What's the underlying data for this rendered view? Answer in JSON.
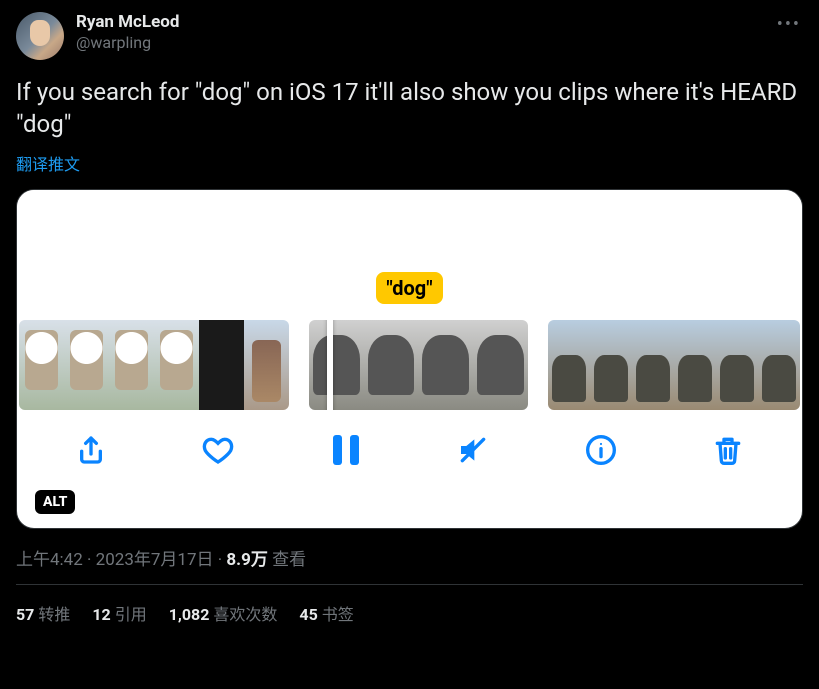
{
  "author": {
    "display_name": "Ryan McLeod",
    "handle": "@warpling"
  },
  "tweet_text": "If you search for \"dog\" on iOS 17 it'll also show you clips where it's HEARD \"dog\"",
  "translate_label": "翻译推文",
  "media": {
    "search_term": "\"dog\"",
    "alt_badge": "ALT"
  },
  "meta": {
    "time": "上午4:42",
    "date": "2023年7月17日",
    "views_number": "8.9万",
    "views_label": "查看",
    "separator": " · "
  },
  "stats": {
    "retweets": {
      "count": "57",
      "label": "转推"
    },
    "quotes": {
      "count": "12",
      "label": "引用"
    },
    "likes": {
      "count": "1,082",
      "label": "喜欢次数"
    },
    "bookmarks": {
      "count": "45",
      "label": "书签"
    }
  },
  "icons": {
    "more": "•••"
  }
}
